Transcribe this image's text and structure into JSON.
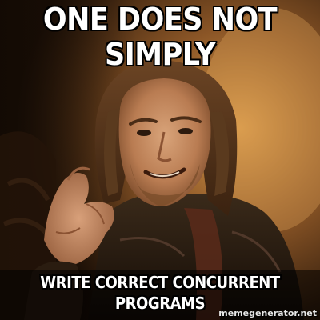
{
  "meme": {
    "top_text_line1": "ONE DOES NOT",
    "top_text_line2": "SIMPLY",
    "bottom_text_line1": "WRITE CORRECT CONCURRENT",
    "bottom_text_line2": "PROGRAMS",
    "watermark": "memegenerator.net"
  },
  "colors": {
    "caption_text": "#ffffff",
    "caption_outline": "#000000",
    "background_dark": "#1a0f07",
    "background_warm": "#c9853a"
  }
}
